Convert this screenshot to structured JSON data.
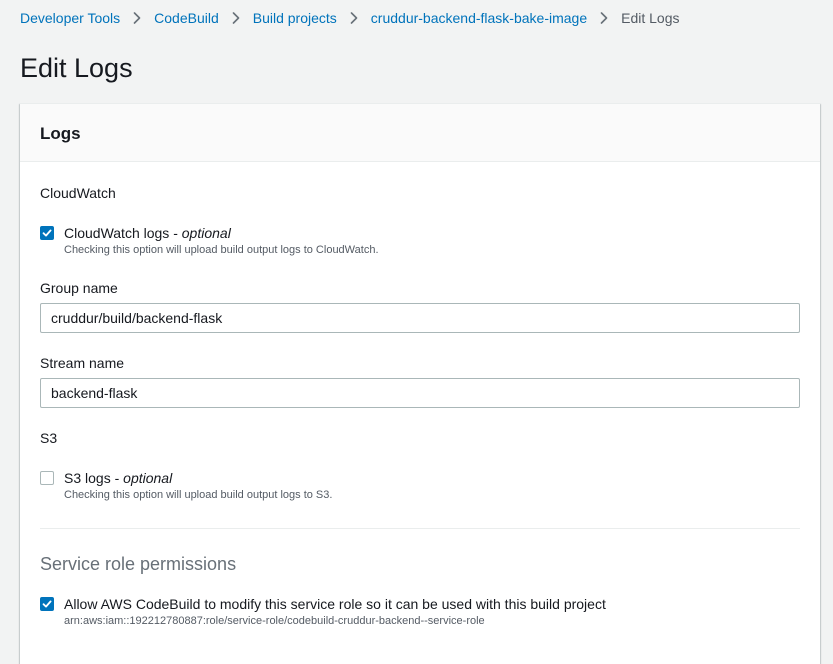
{
  "breadcrumb": {
    "items": [
      "Developer Tools",
      "CodeBuild",
      "Build projects",
      "cruddur-backend-flask-bake-image"
    ],
    "current": "Edit Logs"
  },
  "page": {
    "title": "Edit Logs"
  },
  "panel": {
    "title": "Logs"
  },
  "cloudwatch": {
    "section_label": "CloudWatch",
    "checkbox_label": "CloudWatch logs",
    "checkbox_optional": "optional",
    "checkbox_checked": true,
    "checkbox_desc": "Checking this option will upload build output logs to CloudWatch.",
    "group_name_label": "Group name",
    "group_name_value": "cruddur/build/backend-flask",
    "stream_name_label": "Stream name",
    "stream_name_value": "backend-flask"
  },
  "s3": {
    "section_label": "S3",
    "checkbox_label": "S3 logs",
    "checkbox_optional": "optional",
    "checkbox_checked": false,
    "checkbox_desc": "Checking this option will upload build output logs to S3."
  },
  "service_role": {
    "heading": "Service role permissions",
    "checkbox_label": "Allow AWS CodeBuild to modify this service role so it can be used with this build project",
    "checkbox_checked": true,
    "checkbox_desc": "arn:aws:iam::192212780887:role/service-role/codebuild-cruddur-backend--service-role"
  },
  "icons": {
    "breadcrumb_separator": "chevron-right-icon",
    "checkmark": "checkmark-icon"
  },
  "colors": {
    "link": "#0073bb",
    "checkbox_checked": "#0073bb",
    "text_primary": "#16191f",
    "text_secondary": "#545b64",
    "background": "#f2f3f3"
  }
}
